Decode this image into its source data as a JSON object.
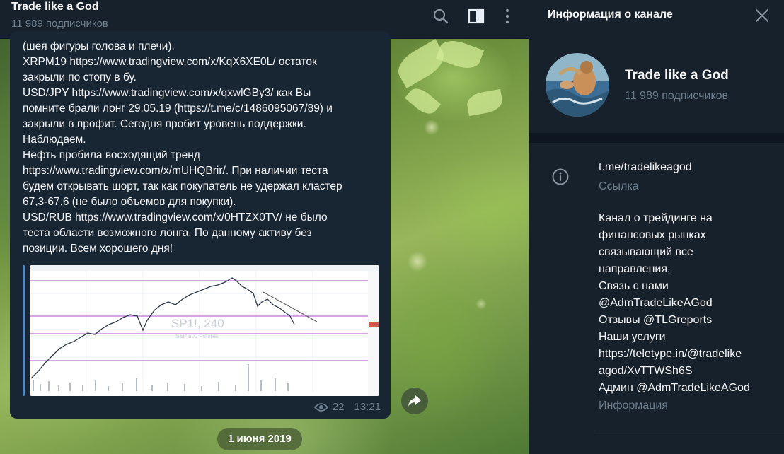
{
  "chat": {
    "title": "Trade like a God",
    "subscribers": "11 989 подписчиков",
    "message_lines": [
      "(шея фигуры голова и плечи).",
      "XRPM19 https://www.tradingview.com/x/KqX6XE0L/ остаток",
      "закрыли по стопу в бу.",
      "USD/JPY https://www.tradingview.com/x/qxwlGBy3/ как Вы",
      "помните брали лонг 29.05.19 (https://t.me/c/1486095067/89) и",
      "закрыли в профит. Сегодня пробит уровень поддержки.",
      "Наблюдаем.",
      "Нефть пробила восходящий тренд",
      "https://www.tradingview.com/x/mUHQBrir/. При наличии теста",
      "будем открывать шорт, так как покупатель не удержал кластер",
      "67,3-67,6 (не было объемов для покупки).",
      "USD/RUB https://www.tradingview.com/x/0HTZX0TV/ не было",
      "теста области возможного лонга. По данному активу без",
      "позиции. Всем хорошего дня!"
    ],
    "chart_watermark": "SP1!, 240",
    "chart_watermark_sub": "S&P 500 Futures",
    "views": "22",
    "time": "13:21",
    "date_pill": "1 июня 2019"
  },
  "info": {
    "title": "Информация о канале",
    "channel_name": "Trade like a God",
    "subscribers": "11 989 подписчиков",
    "link": "t.me/tradelikeagod",
    "link_label": "Ссылка",
    "description_lines": [
      "Канал о трейдинге на",
      "финансовых рынках",
      "связывающий все",
      "направления.",
      "Связь с нами",
      "@AdmTradeLikeAGod",
      "Отзывы  @TLGreports",
      "Наши услуги",
      "https://teletype.in/@tradelike",
      "agod/XvTTWSh6S",
      "Админ @AdmTradeLikeAGod"
    ],
    "description_label": "Информация"
  },
  "colors": {
    "panel_bg": "#17212b",
    "bubble_bg": "#182533",
    "accent": "#5288c1",
    "muted_text": "#6d7f8f"
  },
  "icons": {
    "search": "search-icon",
    "sidebar": "sidebar-toggle-icon",
    "more": "more-vertical-icon",
    "close": "close-icon",
    "info": "info-icon",
    "share": "share-arrow-icon",
    "views": "eye-icon"
  }
}
